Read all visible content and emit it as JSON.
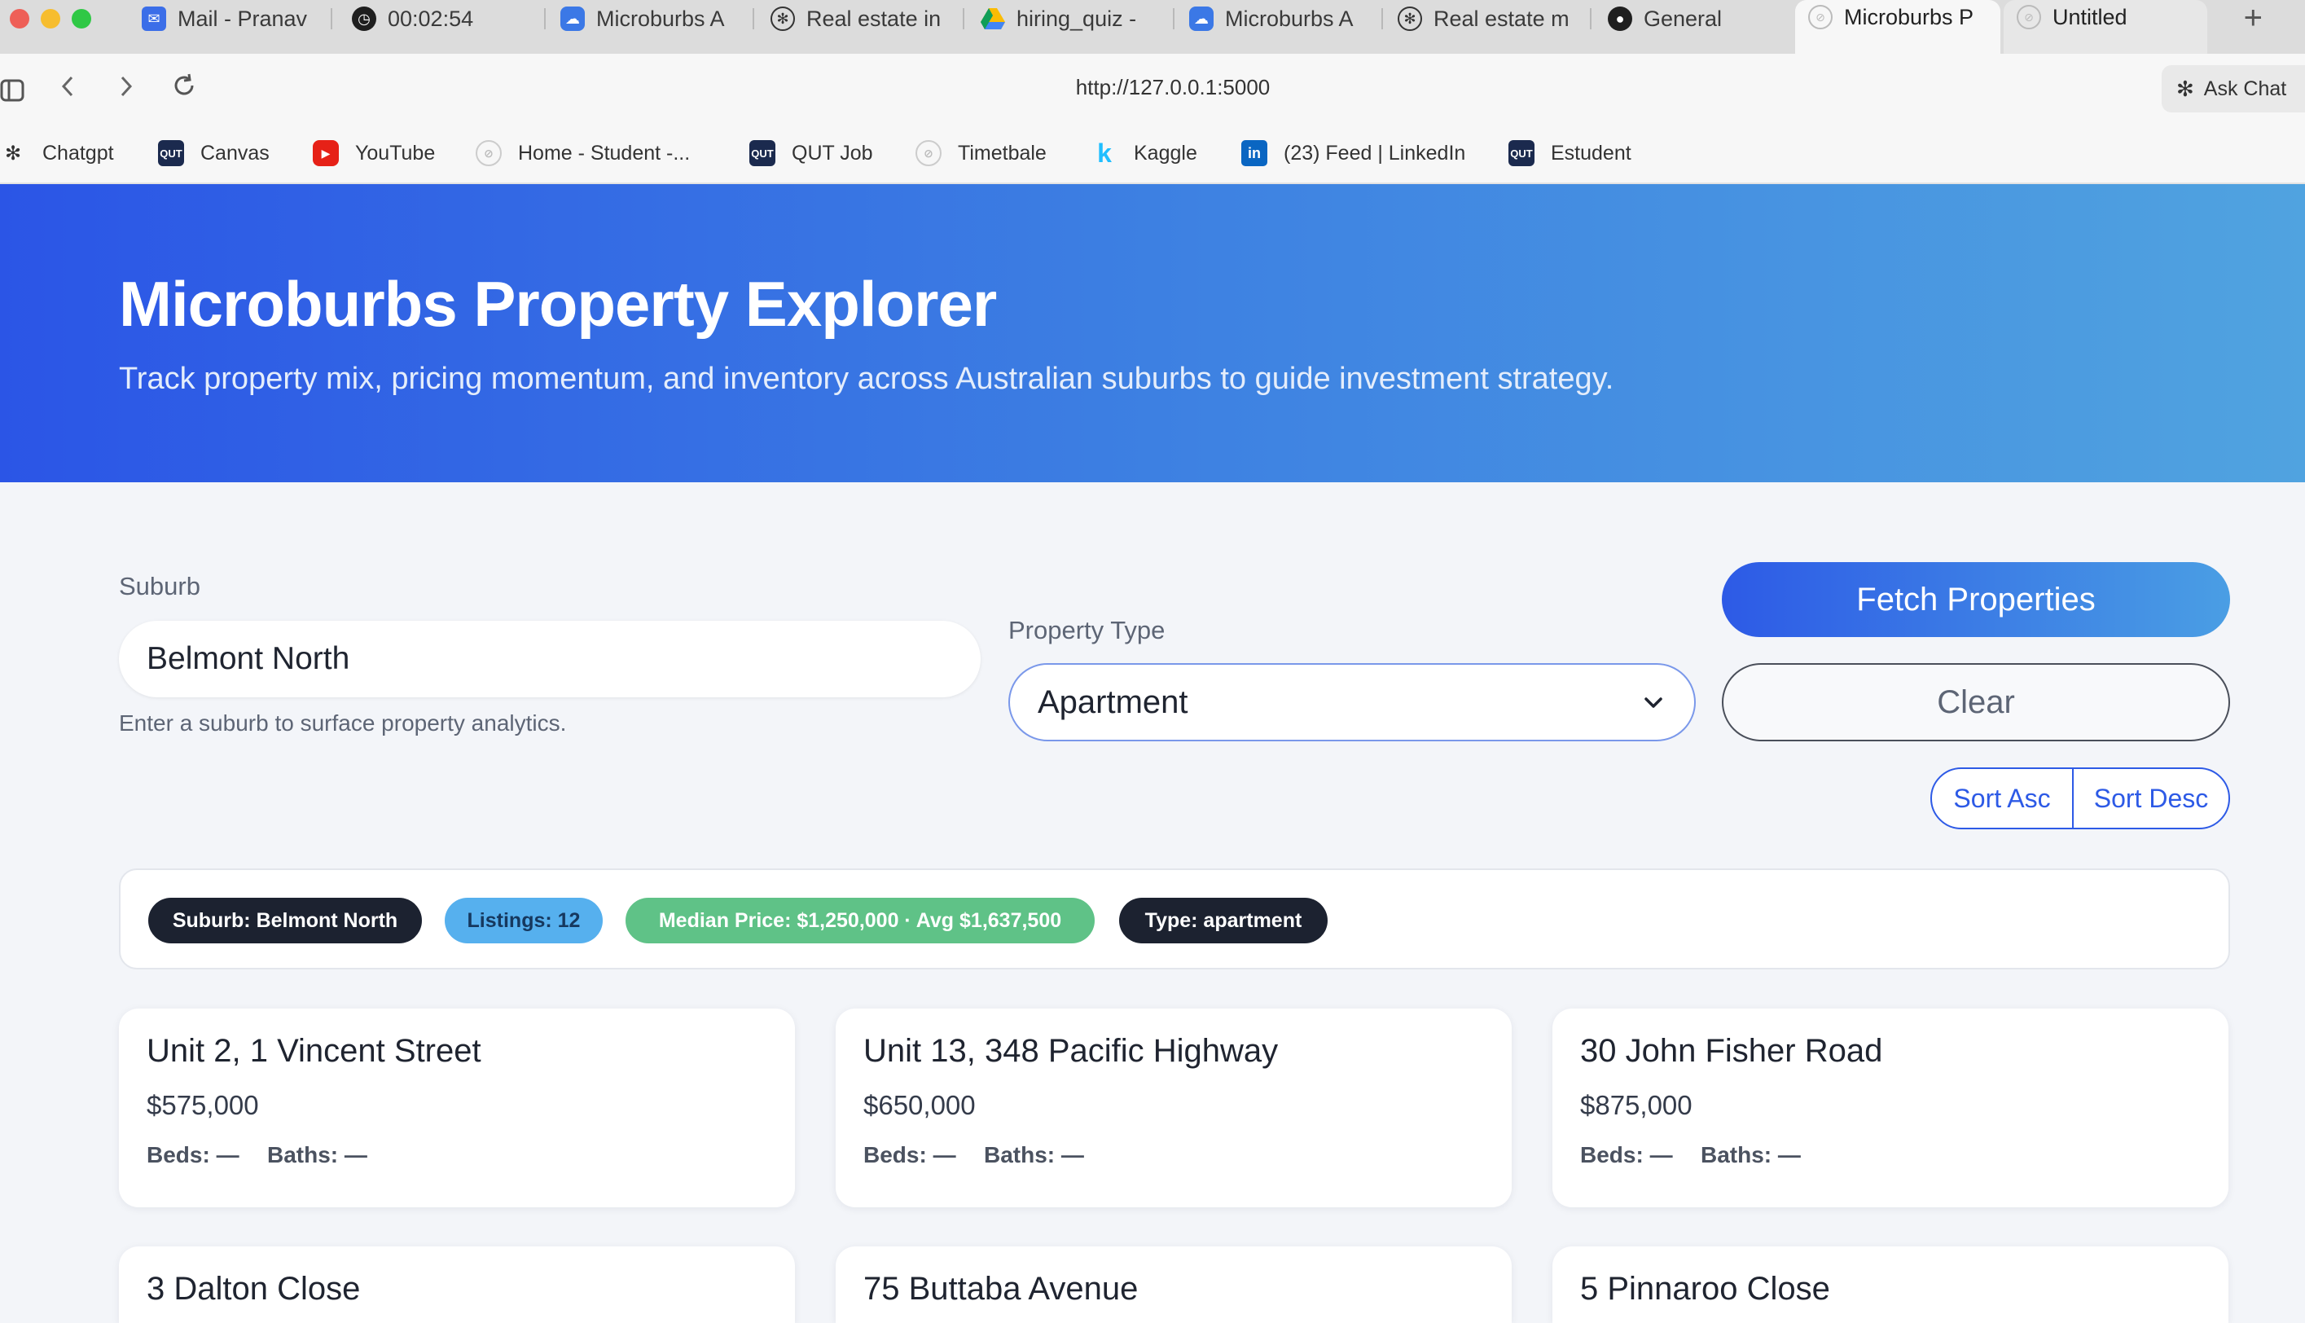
{
  "browser": {
    "tabs": [
      {
        "title": "Mail - Pranav",
        "icon": "mail-icon"
      },
      {
        "title": "00:02:54",
        "icon": "timer-icon"
      },
      {
        "title": "Microburbs A",
        "icon": "microburbs-icon"
      },
      {
        "title": "Real estate in",
        "icon": "chatgpt-icon"
      },
      {
        "title": "hiring_quiz -",
        "icon": "google-drive-icon"
      },
      {
        "title": "Microburbs A",
        "icon": "microburbs-icon"
      },
      {
        "title": "Real estate m",
        "icon": "chatgpt-icon"
      },
      {
        "title": "General",
        "icon": "github-icon"
      },
      {
        "title": "Microburbs P",
        "icon": "compass-icon"
      },
      {
        "title": "Untitled",
        "icon": "compass-icon"
      }
    ],
    "url": "http://127.0.0.1:5000",
    "ask_chat": "Ask Chat",
    "bookmarks": [
      {
        "label": "Chatgpt",
        "icon": "chatgpt-icon"
      },
      {
        "label": "Canvas",
        "icon": "qut-icon"
      },
      {
        "label": "YouTube",
        "icon": "youtube-icon"
      },
      {
        "label": "Home - Student -...",
        "icon": "compass-icon"
      },
      {
        "label": "QUT Job",
        "icon": "qut-icon"
      },
      {
        "label": "Timetbale",
        "icon": "compass-icon"
      },
      {
        "label": "Kaggle",
        "icon": "kaggle-icon"
      },
      {
        "label": "(23) Feed | LinkedIn",
        "icon": "linkedin-icon"
      },
      {
        "label": "Estudent",
        "icon": "qut-icon"
      }
    ]
  },
  "hero": {
    "title": "Microburbs Property Explorer",
    "subtitle": "Track property mix, pricing momentum, and inventory across Australian suburbs to guide investment strategy."
  },
  "controls": {
    "suburb_label": "Suburb",
    "suburb_value": "Belmont North",
    "suburb_hint": "Enter a suburb to surface property analytics.",
    "type_label": "Property Type",
    "type_value": "Apartment",
    "fetch_label": "Fetch Properties",
    "clear_label": "Clear",
    "sort_asc_label": "Sort Asc",
    "sort_desc_label": "Sort Desc"
  },
  "summary": {
    "suburb": "Suburb: Belmont North",
    "listings": "Listings: 12",
    "median": "Median Price: $1,250,000 · Avg $1,637,500",
    "type": "Type: apartment"
  },
  "properties": [
    {
      "address": "Unit 2, 1 Vincent Street",
      "price": "$575,000",
      "beds": "Beds: —",
      "baths": "Baths: —"
    },
    {
      "address": "Unit 13, 348 Pacific Highway",
      "price": "$650,000",
      "beds": "Beds: —",
      "baths": "Baths: —"
    },
    {
      "address": "30 John Fisher Road",
      "price": "$875,000",
      "beds": "Beds: —",
      "baths": "Baths: —"
    },
    {
      "address": "3 Dalton Close"
    },
    {
      "address": "75 Buttaba Avenue"
    },
    {
      "address": "5 Pinnaroo Close"
    }
  ],
  "colors": {
    "accent": "#2d5ae6",
    "hero_start": "#2b55e6",
    "hero_end": "#50a3e0",
    "chip_dark": "#1c2230",
    "chip_blue": "#56b0ee",
    "chip_green": "#5fc287"
  }
}
